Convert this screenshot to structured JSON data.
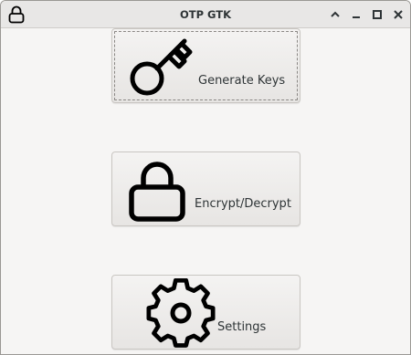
{
  "window": {
    "title": "OTP GTK",
    "controls": {
      "shade": "chevron-up-icon",
      "minimize": "minimize-icon",
      "maximize": "maximize-icon",
      "close": "close-icon"
    },
    "app_icon": "lock-icon"
  },
  "main": {
    "buttons": [
      {
        "label": "Generate Keys",
        "icon": "key-icon"
      },
      {
        "label": "Encrypt/Decrypt",
        "icon": "lock-icon"
      },
      {
        "label": "Settings",
        "icon": "gear-icon"
      }
    ]
  },
  "colors": {
    "window_bg": "#f6f5f4",
    "titlebar_bg": "#e8e7e6",
    "text": "#2e3436",
    "icon": "#000000"
  }
}
